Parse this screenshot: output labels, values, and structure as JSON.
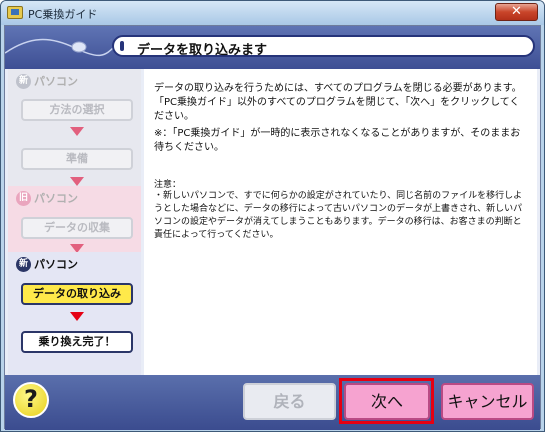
{
  "window": {
    "title": "PC乗換ガイド",
    "close_label": "✕"
  },
  "header": {
    "title": "データを取り込みます"
  },
  "steps": {
    "old_pc_label": "パソコン",
    "old_badge": "新",
    "method_label": "方法の選択",
    "prepare_label": "準備",
    "old_pc2_label": "パソコン",
    "old_badge2": "旧",
    "collect_label": "データの収集",
    "new_pc_label": "パソコン",
    "new_badge": "新",
    "import_label": "データの取り込み",
    "finish_label": "乗り換え完了！"
  },
  "content": {
    "para1": "データの取り込みを行うためには、すべてのプログラムを閉じる必要があります。「PC乗換ガイド」以外のすべてのプログラムを閉じて、「次へ」をクリックしてください。",
    "note_star": "※：「PC乗換ガイド」が一時的に表示されなくなることがありますが、そのままお待ちください。",
    "caution_title": "注意：",
    "caution_body": "・新しいパソコンで、すでに何らかの設定がされていたり、同じ名前のファイルを移行しようとした場合などに、データの移行によって古いパソコンのデータが上書きされ、新しいパソコンの設定やデータが消えてしまうこともあります。データの移行は、お客さまの判断と責任によって行ってください。"
  },
  "footer": {
    "help_label": "?",
    "back_label": "戻る",
    "next_label": "次へ",
    "cancel_label": "キャンセル"
  },
  "colors": {
    "header_blue": "#4a5ea3",
    "active_step": "#ffe94a",
    "primary_button": "#f6a3d0",
    "highlight_red": "#e60012"
  }
}
